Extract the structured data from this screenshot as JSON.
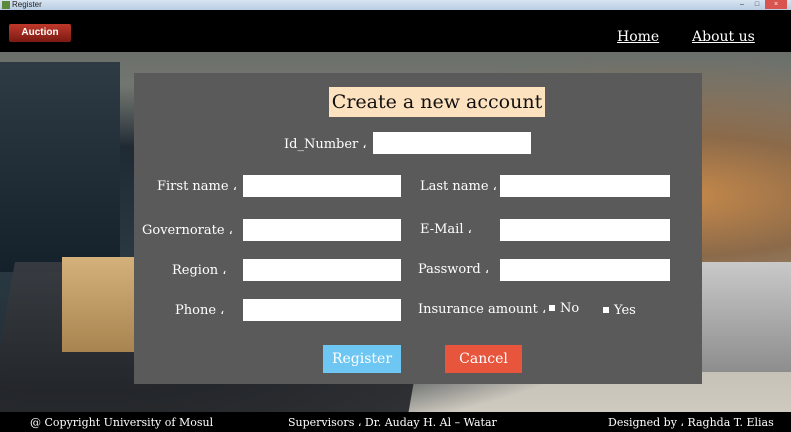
{
  "window": {
    "title": "Register"
  },
  "nav": {
    "logo_text": "Auction",
    "home": "Home",
    "about": "About us"
  },
  "form": {
    "title": "Create a new account",
    "id_number_label": "Id_Number ،",
    "first_name_label": "First name ،",
    "last_name_label": "Last name ،",
    "governorate_label": "Governorate ،",
    "email_label": "E-Mail ،",
    "region_label": "Region ،",
    "password_label": "Password ،",
    "phone_label": "Phone ،",
    "insurance_label": "Insurance amount ،",
    "insurance_no": "No",
    "insurance_yes": "Yes",
    "register_label": "Register",
    "cancel_label": "Cancel"
  },
  "colors": {
    "register": "#6ec6f2",
    "cancel": "#e8553d",
    "title_bg": "#fde2bf",
    "dialog_bg": "#5a5a5a"
  },
  "footer": {
    "copyright": "@ Copyright University of Mosul",
    "supervisors": "Supervisors ، Dr. Auday H.  Al – Watar",
    "designed": "Designed by ، Raghda T. Elias"
  }
}
